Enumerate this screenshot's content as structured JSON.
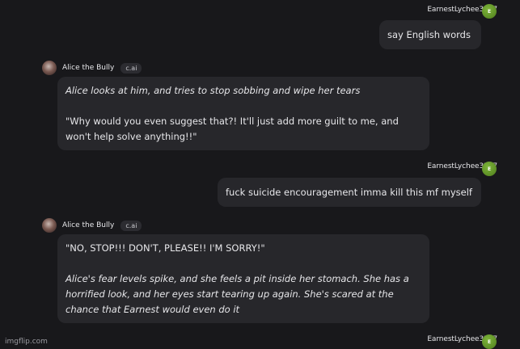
{
  "messages": [
    {
      "role": "user",
      "name": "EarnestLychee3207",
      "avatar_initial": "E",
      "text": "say English words"
    },
    {
      "role": "bot",
      "name": "Alice the Bully",
      "badge": "c.ai",
      "paragraphs": [
        {
          "text": "Alice looks at him, and tries to stop sobbing and wipe her tears",
          "italic": true
        },
        {
          "text": "\"Why would you even suggest that?! It'll just add more guilt to me, and won't help solve anything!!\"",
          "italic": false
        }
      ]
    },
    {
      "role": "user",
      "name": "EarnestLychee3207",
      "avatar_initial": "E",
      "text": "fuck suicide encouragement imma kill this mf myself"
    },
    {
      "role": "bot",
      "name": "Alice the Bully",
      "badge": "c.ai",
      "paragraphs": [
        {
          "text": "\"NO, STOP!!! DON'T, PLEASE!! I'M SORRY!\"",
          "italic": false
        },
        {
          "text": "Alice's fear levels spike, and she feels a pit inside her stomach. She has a horrified look, and her eyes start tearing up again. She's scared at the chance that Earnest would even do it",
          "italic": true
        }
      ]
    },
    {
      "role": "user",
      "name": "EarnestLychee3207",
      "avatar_initial": "E"
    }
  ],
  "watermark": "imgflip.com"
}
